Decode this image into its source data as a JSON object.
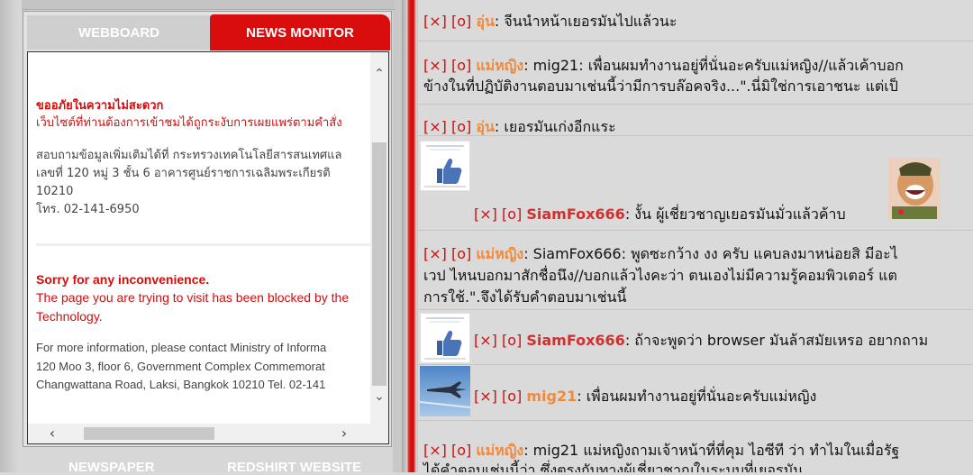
{
  "left": {
    "tabs": {
      "webboard": "WEBBOARD",
      "news": "NEWS MONITOR"
    },
    "bottom_tabs": {
      "newspaper": "NEWSPAPER",
      "redshirt": "REDSHIRT WEBSITE"
    },
    "notice": {
      "th_title": "ขออภัยในความไม่สะดวก",
      "th_line": "เว็บไซต์ที่ท่านต้องการเข้าชมได้ถูกระงับการเผยแพร่ตามคำสั่ง",
      "th_info1": "สอบถามข้อมูลเพิ่มเติมได้ที่   กระทรวงเทคโนโลยีสารสนเทศแล",
      "th_info2": "เลขที่   120 หมู่  3 ชั้น   6 อาคารศูนย์ราชการเฉลิมพระเกียรติ",
      "th_info3": "10210",
      "th_info4": "โทร. 02-141-6950",
      "en_title": "Sorry for any inconvenience.",
      "en_line1": "The page you are trying to visit has been blocked by the",
      "en_line2": "Technology.",
      "en_info1": "For more information, please contact Ministry of Informa",
      "en_info2": "120 Moo 3, floor 6, Government Complex Commemorat",
      "en_info3": "Changwattana Road, Laksi, Bangkok 10210 Tel. 02-141"
    }
  },
  "chat": {
    "x": "[×]",
    "o": "[o]",
    "messages": [
      {
        "user": "อุ่น",
        "text": ": จีนนำหน้าเยอรมันไปแล้วนะ"
      },
      {
        "user": "แม่หญิง",
        "text": ": mig21: เพื่อนผมทำงานอยู่ที่นั่นอะครับแม่หญิง//แล้วเค้าบอก",
        "text2": "ข้างในที่ปฏิบัติงานตอบมาเช่นนี้ว่ามีการบล๊อคจริง...\".นี่มิใช่การเอาชนะ แต่เป็"
      },
      {
        "user": "อุ่น",
        "text": ": เยอรมันเก่งอีกแระ"
      },
      {
        "user": "SiamFox666",
        "text": ": งั้น ผู้เชี่ยวชาญเยอรมันมั่วแล้วค้าบ"
      },
      {
        "user": "แม่หญิง",
        "text": ": SiamFox666: พูดซะกว้าง งง ครับ แคบลงมาหน่อยสิ มีอะไ",
        "text2": "เวป ไหนบอกมาสักชื่อนึง//บอกแล้วไงคะว่า ตนเองไม่มีความรู้คอมพิวเตอร์ แต",
        "text3": "การใช้.\".จึงได้รับคำตอบมาเช่นนี้"
      },
      {
        "user": "SiamFox666",
        "text": ": ถ้าจะพูดว่า browser มันล้าสมัยเหรอ อยากถาม"
      },
      {
        "user": "mig21",
        "text": ": เพื่อนผมทำงานอยู่ที่นั่นอะครับแม่หญิง"
      },
      {
        "user": "แม่หญิง",
        "text": ": mig21 แม่หญิงถามเจ้าหน้าที่ที่คุม ไอซีที ว่า ทำไมในเมื่อรัฐ",
        "text2": "ได้คำตอบเช่นนี้ว่า ซึ่งตรงกับทางผู้เชี่ยวชาญในระบบที่เยอรมัน"
      }
    ]
  },
  "colors": {
    "accent_red": "#d90d0d",
    "username_orange": "#f08a3c",
    "username_red": "#d03030"
  },
  "icons": [
    "thumbs-up-icon",
    "fighter-jet-icon",
    "laughing-soldier-avatar"
  ]
}
